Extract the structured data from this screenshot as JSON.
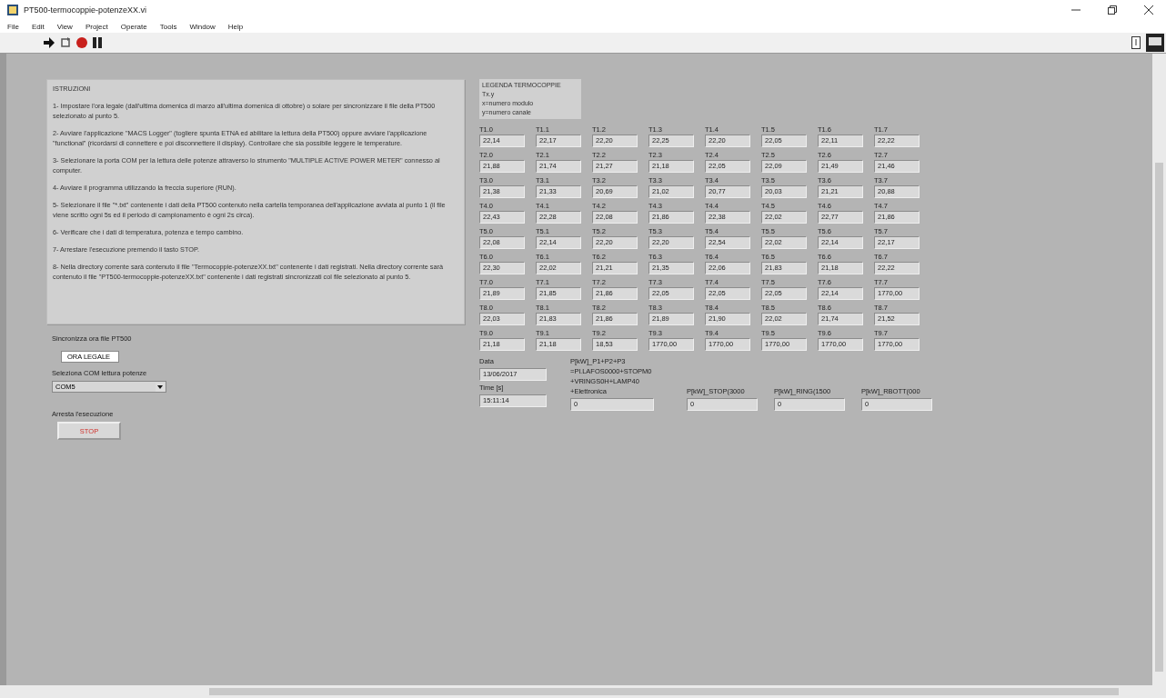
{
  "window": {
    "title": "PT500-termocoppie-potenzeXX.vi"
  },
  "menu": [
    "File",
    "Edit",
    "View",
    "Project",
    "Operate",
    "Tools",
    "Window",
    "Help"
  ],
  "instructions": {
    "title": "ISTRUZIONI",
    "steps": [
      "1- Impostare l'ora legale (dall'ultima domenica di marzo all'ultima domenica di ottobre) o solare per sincronizzare il file della PT500 selezionato al punto 5.",
      "2- Avviare l'applicazione \"MACS Logger\" (togliere spunta ETNA ed abilitare la lettura della PT500) oppure avviare l'applicazione \"functional\" (ricordarsi di connettere e poi disconnettere il display). Controllare che sia possibile leggere le temperature.",
      "3- Selezionare la porta COM per la lettura delle potenze attraverso lo strumento \"MULTIPLE ACTIVE POWER METER\" connesso al computer.",
      "4- Avviare il programma utilizzando la freccia superiore (RUN).",
      "5- Selezionare il file \"*.txt\" contenente i dati della PT500 contenuto nella cartella temporanea dell'applicazione avviata al punto 1 (il file viene scritto ogni 5s ed il periodo di campionamento è ogni 2s circa).",
      "6- Verificare che i dati di temperatura, potenza e tempo cambino.",
      "7- Arrestare l'esecuzione premendo il tasto STOP.",
      "8- Nella directory corrente sarà contenuto il file \"Termocoppie-potenzeXX.txt\" contenente i dati registrati. Nella directory corrente sarà contenuto il file \"PT500-termocoppie-potenzeXX.txt\" contenente i dati registrati sincronizzati col file selezionato al punto 5."
    ]
  },
  "sync": {
    "label": "Sincronizza ora file PT500",
    "value": "ORA LEGALE"
  },
  "com": {
    "label": "Seleziona COM lettura potenze",
    "value": "COM5"
  },
  "stop": {
    "label": "Arresta l'esecuzione",
    "button": "STOP"
  },
  "legend": {
    "title": "LEGENDA TERMOCOPPIE",
    "lines": [
      "Tx.y",
      "x=numero modulo",
      "y=numero canale"
    ]
  },
  "thermocouples": [
    [
      {
        "label": "T1.0",
        "value": "22,14"
      },
      {
        "label": "T1.1",
        "value": "22,17"
      },
      {
        "label": "T1.2",
        "value": "22,20"
      },
      {
        "label": "T1.3",
        "value": "22,25"
      },
      {
        "label": "T1.4",
        "value": "22,20"
      },
      {
        "label": "T1.5",
        "value": "22,05"
      },
      {
        "label": "T1.6",
        "value": "22,11"
      },
      {
        "label": "T1.7",
        "value": "22,22"
      }
    ],
    [
      {
        "label": "T2.0",
        "value": "21,88"
      },
      {
        "label": "T2.1",
        "value": "21,74"
      },
      {
        "label": "T2.2",
        "value": "21,27"
      },
      {
        "label": "T2.3",
        "value": "21,18"
      },
      {
        "label": "T2.4",
        "value": "22,05"
      },
      {
        "label": "T2.5",
        "value": "22,09"
      },
      {
        "label": "T2.6",
        "value": "21,49"
      },
      {
        "label": "T2.7",
        "value": "21,46"
      }
    ],
    [
      {
        "label": "T3.0",
        "value": "21,38"
      },
      {
        "label": "T3.1",
        "value": "21,33"
      },
      {
        "label": "T3.2",
        "value": "20,69"
      },
      {
        "label": "T3.3",
        "value": "21,02"
      },
      {
        "label": "T3.4",
        "value": "20,77"
      },
      {
        "label": "T3.5",
        "value": "20,03"
      },
      {
        "label": "T3.6",
        "value": "21,21"
      },
      {
        "label": "T3.7",
        "value": "20,88"
      }
    ],
    [
      {
        "label": "T4.0",
        "value": "22,43"
      },
      {
        "label": "T4.1",
        "value": "22,28"
      },
      {
        "label": "T4.2",
        "value": "22,08"
      },
      {
        "label": "T4.3",
        "value": "21,86"
      },
      {
        "label": "T4.4",
        "value": "22,38"
      },
      {
        "label": "T4.5",
        "value": "22,02"
      },
      {
        "label": "T4.6",
        "value": "22,77"
      },
      {
        "label": "T4.7",
        "value": "21,86"
      }
    ],
    [
      {
        "label": "T5.0",
        "value": "22,08"
      },
      {
        "label": "T5.1",
        "value": "22,14"
      },
      {
        "label": "T5.2",
        "value": "22,20"
      },
      {
        "label": "T5.3",
        "value": "22,20"
      },
      {
        "label": "T5.4",
        "value": "22,54"
      },
      {
        "label": "T5.5",
        "value": "22,02"
      },
      {
        "label": "T5.6",
        "value": "22,14"
      },
      {
        "label": "T5.7",
        "value": "22,17"
      }
    ],
    [
      {
        "label": "T6.0",
        "value": "22,30"
      },
      {
        "label": "T6.1",
        "value": "22,02"
      },
      {
        "label": "T6.2",
        "value": "21,21"
      },
      {
        "label": "T6.3",
        "value": "21,35"
      },
      {
        "label": "T6.4",
        "value": "22,06"
      },
      {
        "label": "T6.5",
        "value": "21,83"
      },
      {
        "label": "T6.6",
        "value": "21,18"
      },
      {
        "label": "T6.7",
        "value": "22,22"
      }
    ],
    [
      {
        "label": "T7.0",
        "value": "21,89"
      },
      {
        "label": "T7.1",
        "value": "21,85"
      },
      {
        "label": "T7.2",
        "value": "21,86"
      },
      {
        "label": "T7.3",
        "value": "22,05"
      },
      {
        "label": "T7.4",
        "value": "22,05"
      },
      {
        "label": "T7.5",
        "value": "22,05"
      },
      {
        "label": "T7.6",
        "value": "22,14"
      },
      {
        "label": "T7.7",
        "value": "1770,00"
      }
    ],
    [
      {
        "label": "T8.0",
        "value": "22,03"
      },
      {
        "label": "T8.1",
        "value": "21,83"
      },
      {
        "label": "T8.2",
        "value": "21,86"
      },
      {
        "label": "T8.3",
        "value": "21,89"
      },
      {
        "label": "T8.4",
        "value": "21,90"
      },
      {
        "label": "T8.5",
        "value": "22,02"
      },
      {
        "label": "T8.6",
        "value": "21,74"
      },
      {
        "label": "T8.7",
        "value": "21,52"
      }
    ],
    [
      {
        "label": "T9.0",
        "value": "21,18"
      },
      {
        "label": "T9.1",
        "value": "21,18"
      },
      {
        "label": "T9.2",
        "value": "18,53"
      },
      {
        "label": "T9.3",
        "value": "1770,00"
      },
      {
        "label": "T9.4",
        "value": "1770,00"
      },
      {
        "label": "T9.5",
        "value": "1770,00"
      },
      {
        "label": "T9.6",
        "value": "1770,00"
      },
      {
        "label": "T9.7",
        "value": "1770,00"
      }
    ]
  ],
  "date": {
    "label": "Data",
    "value": "13/06/2017"
  },
  "time": {
    "label": "Time [s]",
    "value": "15:11:14"
  },
  "powers": [
    {
      "label": "P[kW]_P1+P2+P3 =Pl.LAFOS0000+STOPM0 +VRINGS0H+LAMP40 +Elettronica",
      "value": "0"
    },
    {
      "label": "P[kW]_STOP(3000",
      "value": "0"
    },
    {
      "label": "P[kW]_RING(1500",
      "value": "0"
    },
    {
      "label": "P[kW]_RBOTT(000",
      "value": "0"
    }
  ]
}
